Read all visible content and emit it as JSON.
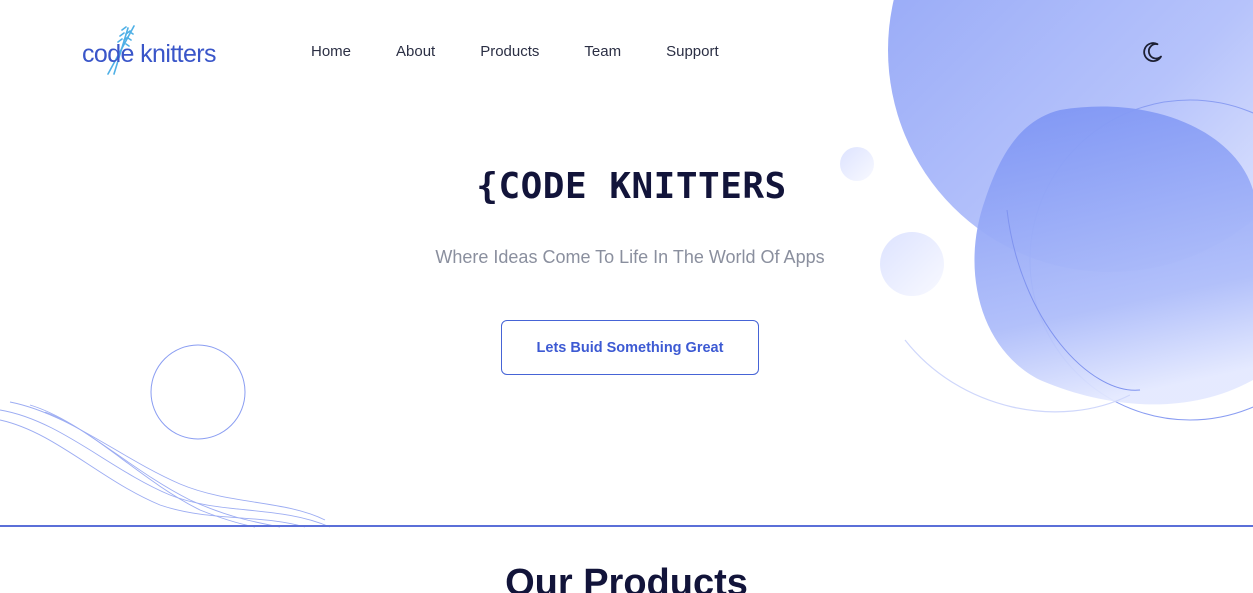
{
  "brand": {
    "logo_text": "code knitters"
  },
  "nav": {
    "items": [
      {
        "label": "Home"
      },
      {
        "label": "About"
      },
      {
        "label": "Products"
      },
      {
        "label": "Team"
      },
      {
        "label": "Support"
      }
    ]
  },
  "header": {
    "theme_toggle_icon": "moon-icon"
  },
  "hero": {
    "title": "{CODE KNITTERS",
    "subtitle": "Where Ideas Come To Life In The World Of Apps",
    "cta_label": "Lets Buid Something Great"
  },
  "products": {
    "section_title": "Our Products"
  },
  "colors": {
    "accent": "#4664d6",
    "blob_light": "#c9d2fb",
    "blob_main": "#8fa3f5",
    "title": "#12143a",
    "subtitle": "#8a8f9e"
  }
}
